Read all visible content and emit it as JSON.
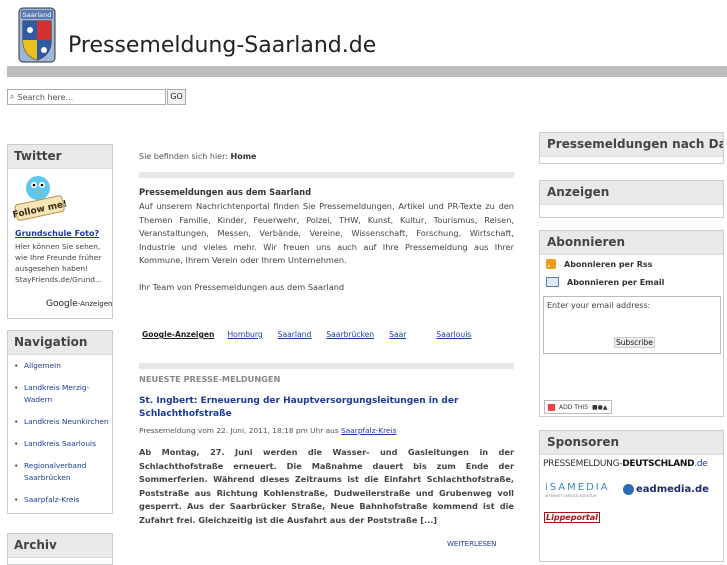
{
  "header": {
    "site_title": "Pressemeldung-Saarland.de",
    "logo_text": "Saarland"
  },
  "search": {
    "placeholder": "Search here...",
    "go_label": "GO"
  },
  "left": {
    "twitter": {
      "title": "Twitter",
      "follow_image_text": "Follow me!",
      "ad_link": "Grundschule Foto?",
      "ad_text": "Hier können Sie sehen, wie Ihre Freunde früher ausgesehen haben! StayFriends.de/Grund...",
      "google_ads": "Google",
      "google_ads_suffix": "-Anzeigen"
    },
    "navigation": {
      "title": "Navigation",
      "items": [
        "Allgemein",
        "Landkreis Merzig-Wadern",
        "Landkreis Neunkirchen",
        "Landkreis Saarlouis",
        "Regionalverband Saarbrücken",
        "Saarpfalz-Kreis"
      ]
    },
    "archiv_title": "Archiv"
  },
  "main": {
    "breadcrumb_prefix": "Sie befinden sich hier:",
    "breadcrumb_current": "Home",
    "intro_title": "Pressemeldungen aus dem Saarland",
    "intro_body": "Auf unserem Nachrichtenportal finden Sie Pressemeldungen, Artikel und PR-Texte zu den Themen Familie, Kinder, Feuerwehr, Polzei, THW, Kunst, Kultur, Tourismus, Reisen, Veranstaltungen, Messen, Verbände, Vereine, Wissenschaft, Forschung, Wirtschaft, Industrie und vieles mehr. Wir freuen uns auch auf Ihre Pressemeldung aus Ihrer Kommune, Ihrem Verein oder Ihrem Unternehmen.",
    "intro_sign": "Ihr Team von Pressemeldungen aus dem Saarland",
    "ads": {
      "label": "Google-Anzeigen",
      "links": [
        "Homburg",
        "Saarland",
        "Saarbrücken",
        "Saar",
        "Saarlouis"
      ]
    },
    "latest_header": "NEUESTE PRESSE-MELDUNGEN",
    "article": {
      "title": "St. Ingbert: Erneuerung der Hauptversorgungsleitungen in der Schlachthofstraße",
      "meta": "Pressemeldung vom 22. Juni, 2011, 18:18 pm Uhr aus",
      "meta_category": "Saarpfalz-Kreis",
      "body": "Ab Montag, 27. Juni werden die Wasser- und Gasleitungen in der Schlachthofstraße erneuert. Die Maßnahme dauert bis zum Ende der Sommerferien. Während dieses Zeitraums ist die Einfahrt Schlachthofstraße, Poststraße aus Richtung Kohlenstraße, Dudweilerstraße und Grubenweg voll gesperrt. Aus der Saarbrücker Straße, Neue Bahnhofstraße kommend ist die Zufahrt frei. Gleichzeitig ist die Ausfahrt aus der Poststraße [...]",
      "more": "WEITERLESEN"
    }
  },
  "right": {
    "datum_title": "Pressemeldungen nach Datum",
    "anzeigen_title": "Anzeigen",
    "abo": {
      "title": "Abonnieren",
      "rss": "Abonnieren per Rss",
      "email": "Abonnieren per Email",
      "email_placeholder": "Enter your email address:",
      "subscribe": "Subscribe",
      "addthis": "ADD THIS"
    },
    "sponsors": {
      "title": "Sponsoren",
      "pm_prefix": "PRESSEMELDUNG-",
      "pm_bold": "DEUTSCHLAND",
      "pm_suffix": ".de",
      "isa": "iSAMEDIA",
      "isa_sub": "INTERNET SERVICE AGENTUR",
      "ead": "eadmedia.de",
      "lippe": "Lippeportal"
    }
  }
}
